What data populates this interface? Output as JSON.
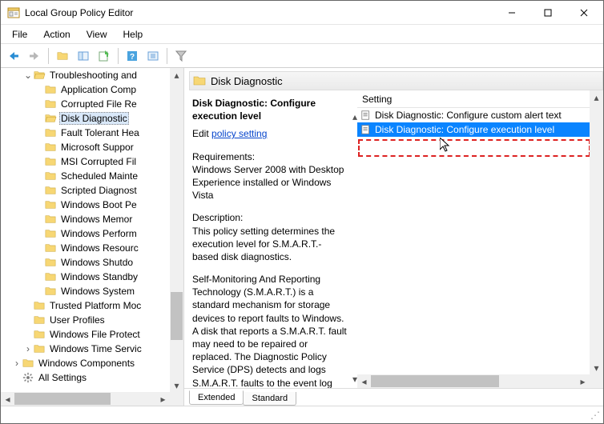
{
  "window": {
    "title": "Local Group Policy Editor"
  },
  "menu": {
    "file": "File",
    "action": "Action",
    "view": "View",
    "help": "Help"
  },
  "tree": {
    "root": "Troubleshooting and",
    "items": [
      "Application Comp",
      "Corrupted File Re",
      "Disk Diagnostic",
      "Fault Tolerant Hea",
      "Microsoft Suppor",
      "MSI Corrupted Fil",
      "Scheduled Mainte",
      "Scripted Diagnost",
      "Windows Boot Pe",
      "Windows Memor",
      "Windows Perform",
      "Windows Resourc",
      "Windows Shutdo",
      "Windows Standby",
      "Windows System"
    ],
    "siblings": [
      "Trusted Platform Moc",
      "User Profiles",
      "Windows File Protect",
      "Windows Time Servic"
    ],
    "winComponents": "Windows Components",
    "allSettings": "All Settings"
  },
  "header": {
    "title": "Disk Diagnostic"
  },
  "desc": {
    "title": "Disk Diagnostic: Configure execution level",
    "editPrefix": "Edit",
    "editLink": "policy setting",
    "reqLabel": "Requirements:",
    "reqText": "Windows Server 2008 with Desktop Experience installed or Windows Vista",
    "descLabel": "Description:",
    "descText1": "This policy setting determines the execution level for S.M.A.R.T.-based disk diagnostics.",
    "descText2": "Self-Monitoring And Reporting Technology (S.M.A.R.T.) is a standard mechanism for storage devices to report faults to Windows. A disk that reports a S.M.A.R.T. fault may need to be repaired or replaced. The Diagnostic Policy Service (DPS) detects and logs S.M.A.R.T. faults to the event log when they occur"
  },
  "list": {
    "setting": "Setting",
    "items": [
      "Disk Diagnostic: Configure custom alert text",
      "Disk Diagnostic: Configure execution level"
    ]
  },
  "tabs": {
    "extended": "Extended",
    "standard": "Standard"
  }
}
